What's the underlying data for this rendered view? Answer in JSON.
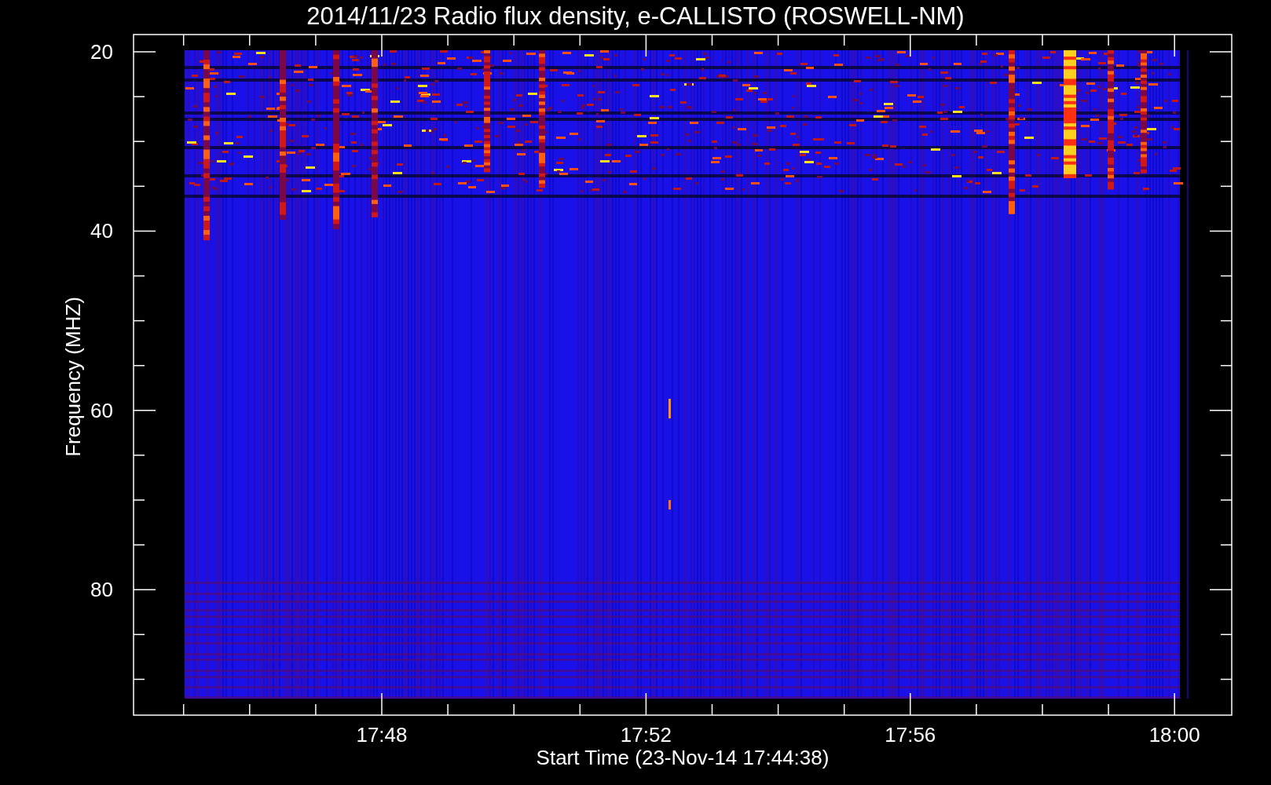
{
  "title": "2014/11/23  Radio flux density, e-CALLISTO (ROSWELL-NM)",
  "y_axis": {
    "label": "Frequency (MHZ)",
    "ticks": [
      "20",
      "40",
      "60",
      "80"
    ]
  },
  "x_axis": {
    "label": "Start Time (23-Nov-14 17:44:38)",
    "ticks": [
      "17:48",
      "17:52",
      "17:56",
      "18:00"
    ]
  }
}
